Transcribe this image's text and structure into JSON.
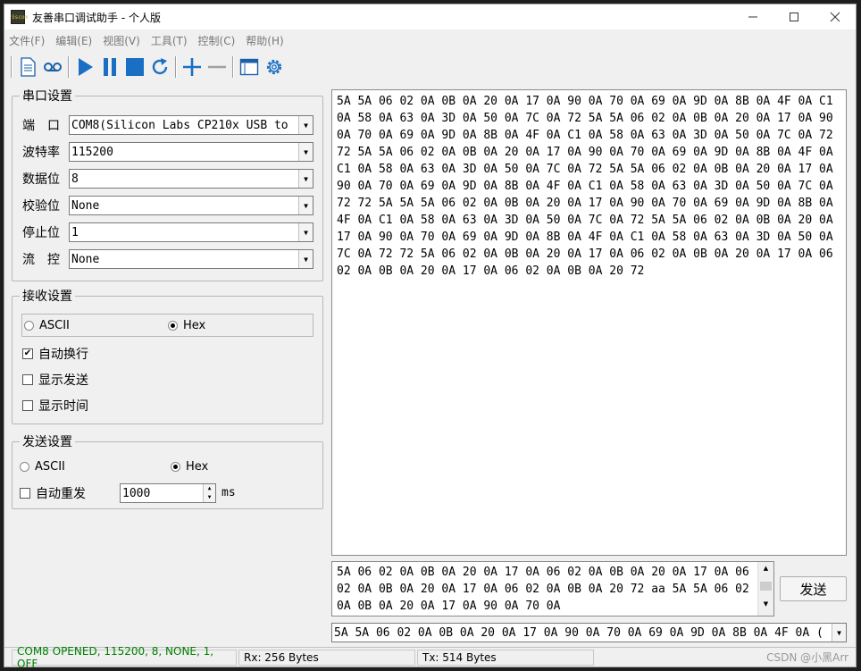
{
  "window": {
    "title": "友善串口调试助手 - 个人版",
    "icon_text": "Sscom",
    "controls": [
      "minimize-icon",
      "maximize-icon",
      "close-icon"
    ]
  },
  "menu": [
    "文件(F)",
    "编辑(E)",
    "视图(V)",
    "工具(T)",
    "控制(C)",
    "帮助(H)"
  ],
  "toolbar": {
    "icons": [
      "document-icon",
      "record-icon",
      "play-icon",
      "pause-icon",
      "stop-icon",
      "refresh-icon",
      "plus-icon",
      "minus-icon",
      "window-icon",
      "gear-icon"
    ],
    "colors": {
      "accent": "#1a6fc4"
    }
  },
  "serial": {
    "legend": "串口设置",
    "port_label": "端　口",
    "port_value": "COM8(Silicon Labs CP210x USB to",
    "baud_label": "波特率",
    "baud_value": "115200",
    "databits_label": "数据位",
    "databits_value": "8",
    "parity_label": "校验位",
    "parity_value": "None",
    "stopbits_label": "停止位",
    "stopbits_value": "1",
    "flow_label": "流　控",
    "flow_value": "None"
  },
  "receive": {
    "legend": "接收设置",
    "ascii_label": "ASCII",
    "hex_label": "Hex",
    "mode": "Hex",
    "auto_wrap_label": "自动换行",
    "auto_wrap_checked": true,
    "show_send_label": "显示发送",
    "show_send_checked": false,
    "show_time_label": "显示时间",
    "show_time_checked": false
  },
  "send": {
    "legend": "发送设置",
    "ascii_label": "ASCII",
    "hex_label": "Hex",
    "mode": "Hex",
    "auto_resend_label": "自动重发",
    "auto_resend_checked": false,
    "interval_value": "1000",
    "interval_unit": "ms"
  },
  "rx_text": "5A 5A 06 02 0A 0B 0A 20 0A 17 0A 90 0A 70 0A 69 0A 9D 0A 8B 0A 4F 0A C1 0A 58 0A 63 0A 3D 0A 50 0A 7C 0A 72 5A 5A 06 02 0A 0B 0A 20 0A 17 0A 90 0A 70 0A 69 0A 9D 0A 8B 0A 4F 0A C1 0A 58 0A 63 0A 3D 0A 50 0A 7C 0A 72 72 5A 5A 06 02 0A 0B 0A 20 0A 17 0A 90 0A 70 0A 69 0A 9D 0A 8B 0A 4F 0A C1 0A 58 0A 63 0A 3D 0A 50 0A 7C 0A 72 5A 5A 06 02 0A 0B 0A 20 0A 17 0A 90 0A 70 0A 69 0A 9D 0A 8B 0A 4F 0A C1 0A 58 0A 63 0A 3D 0A 50 0A 7C 0A 72 72 5A 5A 5A 06 02 0A 0B 0A 20 0A 17 0A 90 0A 70 0A 69 0A 9D 0A 8B 0A 4F 0A C1 0A 58 0A 63 0A 3D 0A 50 0A 7C 0A 72 5A 5A 06 02 0A 0B 0A 20 0A 17 0A 90 0A 70 0A 69 0A 9D 0A 8B 0A 4F 0A C1 0A 58 0A 63 0A 3D 0A 50 0A 7C 0A 72 72 5A 06 02 0A 0B 0A 20 0A 17 0A 06 02 0A 0B 0A 20 0A 17 0A 06 02 0A 0B 0A 20 0A 17 0A 06 02 0A 0B 0A 20 72",
  "tx_text": "5A 06 02 0A 0B 0A 20 0A 17 0A 06 02 0A 0B 0A 20 0A 17 0A 06 02 0A 0B 0A 20 0A 17 0A 06 02 0A 0B 0A 20 72 aa 5A 5A 06 02 0A 0B 0A 20 0A 17 0A 90 0A 70 0A",
  "send_button": "发送",
  "history_value": "5A 5A 06 02 0A 0B 0A 20 0A 17 0A 90 0A 70 0A 69 0A 9D 0A 8B 0A 4F 0A (",
  "status": {
    "connection": "COM8 OPENED, 115200, 8, NONE, 1, OFF",
    "connection_color": "#008000",
    "rx": "Rx: 256 Bytes",
    "tx": "Tx: 514 Bytes"
  },
  "watermark": "CSDN @小黑Arr"
}
